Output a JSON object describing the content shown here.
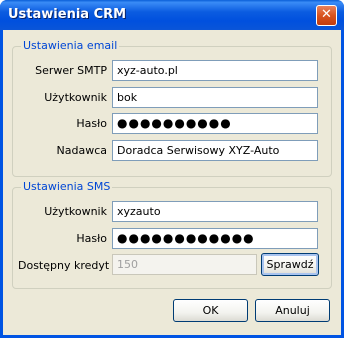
{
  "window": {
    "title": "Ustawienia CRM",
    "close_glyph": "✕"
  },
  "email": {
    "legend": "Ustawienia email",
    "smtp_label": "Serwer SMTP",
    "smtp_value": "xyz-auto.pl",
    "user_label": "Użytkownik",
    "user_value": "bok",
    "password_label": "Hasło",
    "password_value": "●●●●●●●●●●",
    "sender_label": "Nadawca",
    "sender_value": "Doradca Serwisowy XYZ-Auto"
  },
  "sms": {
    "legend": "Ustawienia SMS",
    "user_label": "Użytkownik",
    "user_value": "xyzauto",
    "password_label": "Hasło",
    "password_value": "●●●●●●●●●●●●",
    "credit_label": "Dostępny kredyt",
    "credit_value": "150",
    "check_button": "Sprawdź"
  },
  "footer": {
    "ok": "OK",
    "cancel": "Anuluj"
  }
}
